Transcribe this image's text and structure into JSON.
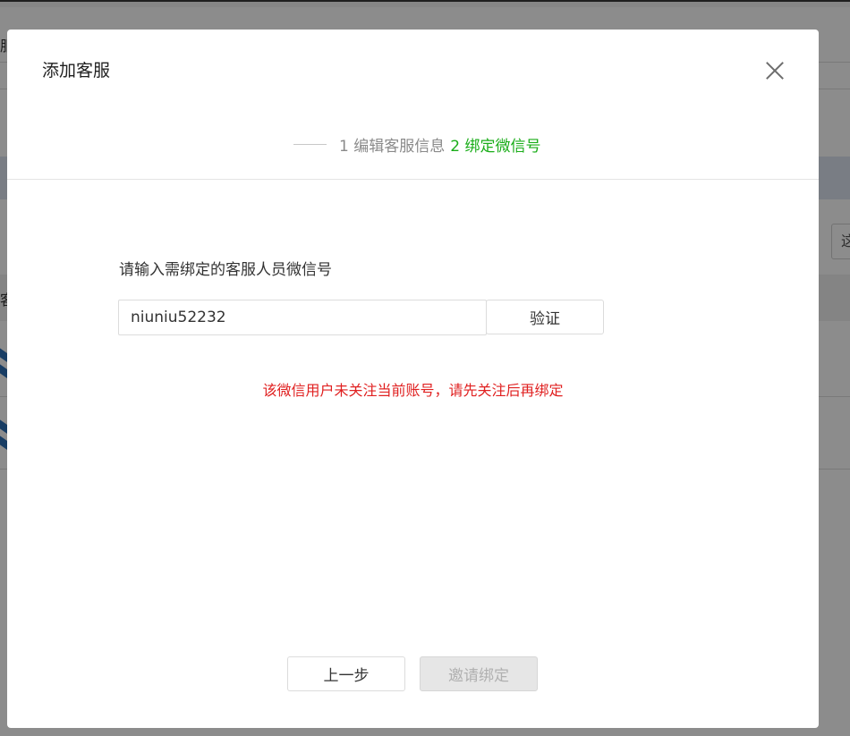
{
  "background": {
    "fragments": [
      "服",
      "客"
    ]
  },
  "dialog": {
    "title": "添加客服",
    "close_icon": "close-icon"
  },
  "steps": {
    "step1": "1 编辑客服信息",
    "step2": "2 绑定微信号",
    "active_step": 2,
    "active_color": "#1aad19"
  },
  "form": {
    "label": "请输入需绑定的客服人员微信号",
    "wechat_id": "niuniu52232",
    "verify_label": "验证"
  },
  "error": {
    "message": "该微信用户未关注当前账号，请先关注后再绑定",
    "color": "#e02020"
  },
  "footer": {
    "prev_label": "上一步",
    "bind_label": "邀请绑定"
  }
}
